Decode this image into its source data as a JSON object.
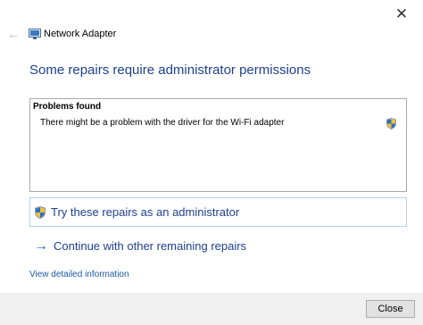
{
  "window": {
    "title": "Network Adapter",
    "close_glyph": "✕",
    "back_glyph": "←"
  },
  "main": {
    "heading": "Some repairs require administrator permissions",
    "problems": {
      "header": "Problems found",
      "items": [
        {
          "text": "There might be a problem with the driver for the Wi-Fi adapter",
          "icon": "uac-shield-icon"
        }
      ]
    },
    "actions": {
      "repair_admin_label": "Try these repairs as an administrator",
      "continue_label": "Continue with other remaining repairs",
      "continue_arrow": "→"
    },
    "detail_link": "View detailed information"
  },
  "footer": {
    "close_label": "Close"
  },
  "colors": {
    "heading_blue": "#1e3f8f",
    "link_blue": "#1e5aa8",
    "footer_bg": "#f0f0f0"
  }
}
